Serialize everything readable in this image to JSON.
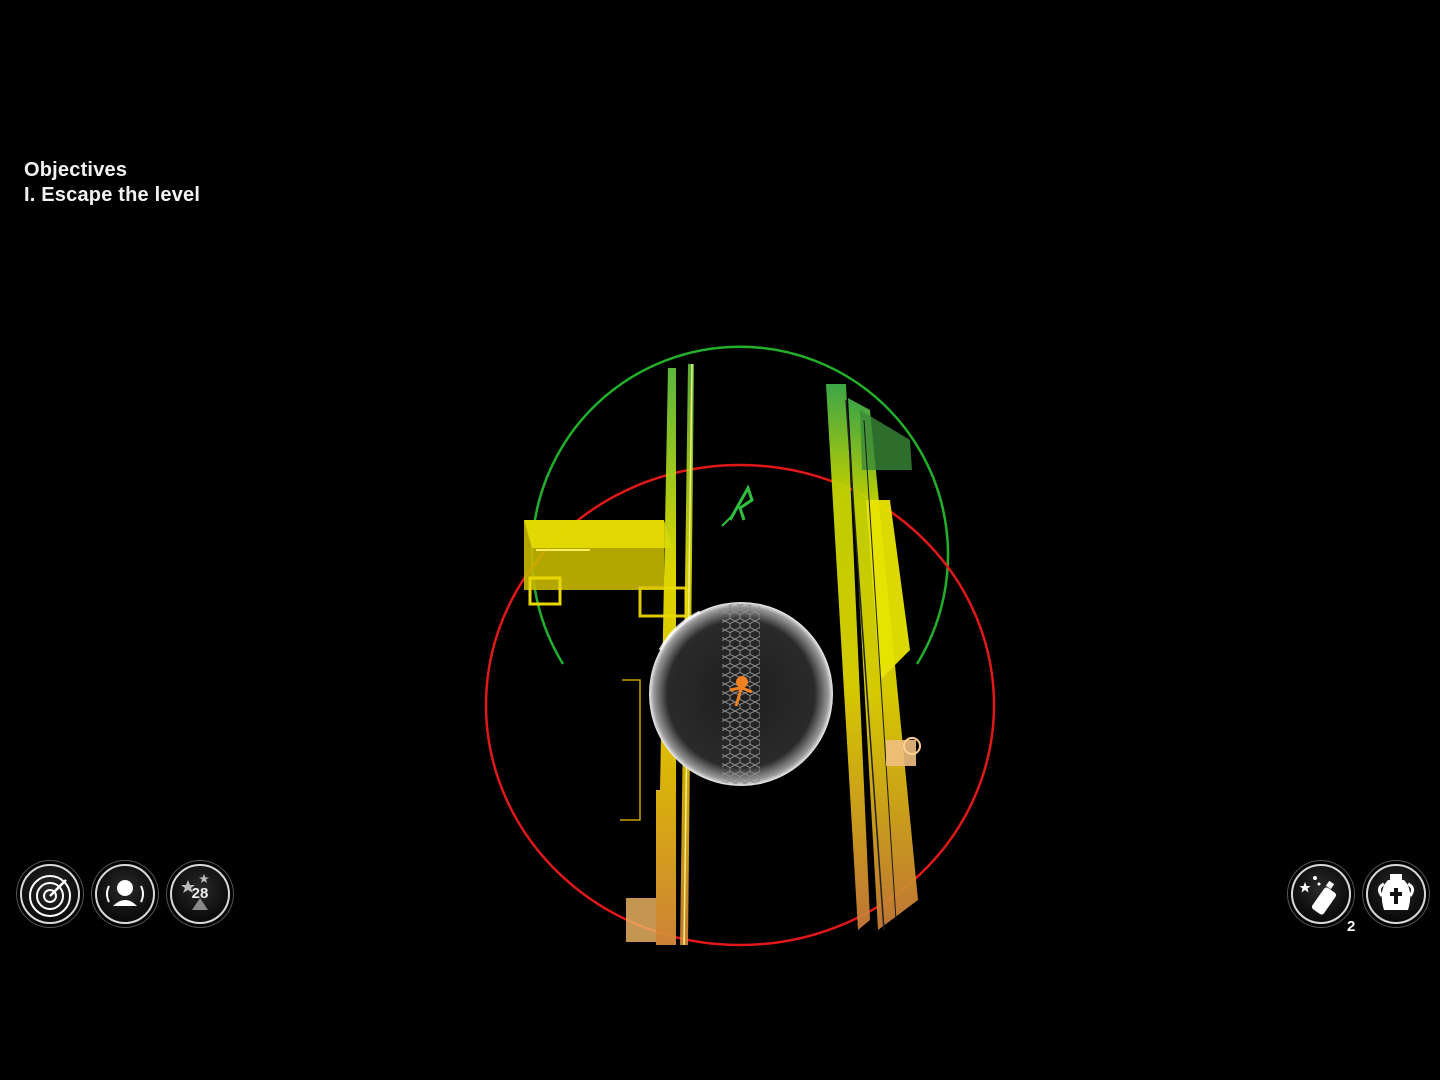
{
  "objectives": {
    "title": "Objectives",
    "items": [
      "I. Escape the level"
    ]
  },
  "hud_left": {
    "radar_icon": "radar-icon",
    "noise_icon": "player-noise-icon",
    "stars_icon": "stars-counter-icon",
    "stars_count": "28"
  },
  "hud_right": {
    "spray_icon": "spray-can-icon",
    "spray_count": "2",
    "vase_icon": "urn-icon"
  },
  "colors": {
    "detection_outer": "#e01818",
    "detection_inner": "#22b02a",
    "wall_yellow": "#e6e600",
    "wall_orange": "#d8843a"
  }
}
